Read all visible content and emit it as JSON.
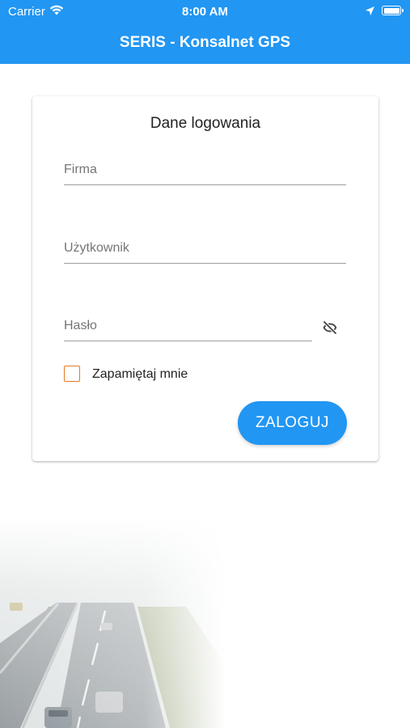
{
  "status_bar": {
    "carrier": "Carrier",
    "time": "8:00 AM",
    "icons": [
      "wifi-icon",
      "location-arrow-icon",
      "battery-icon"
    ]
  },
  "app_bar": {
    "title": "SERIS - Konsalnet GPS",
    "color": "#2196F3"
  },
  "login_card": {
    "title": "Dane logowania",
    "fields": [
      {
        "placeholder": "Firma",
        "value": ""
      },
      {
        "placeholder": "Użytkownik",
        "value": ""
      },
      {
        "placeholder": "Hasło",
        "value": ""
      }
    ],
    "password_toggle_icon": "visibility-off-icon",
    "remember": {
      "label": "Zapamiętaj mnie",
      "checked": false,
      "color": "#E07B23"
    },
    "login_button": "ZALOGUJ"
  },
  "background": {
    "image": "highway-fog-illustration"
  }
}
